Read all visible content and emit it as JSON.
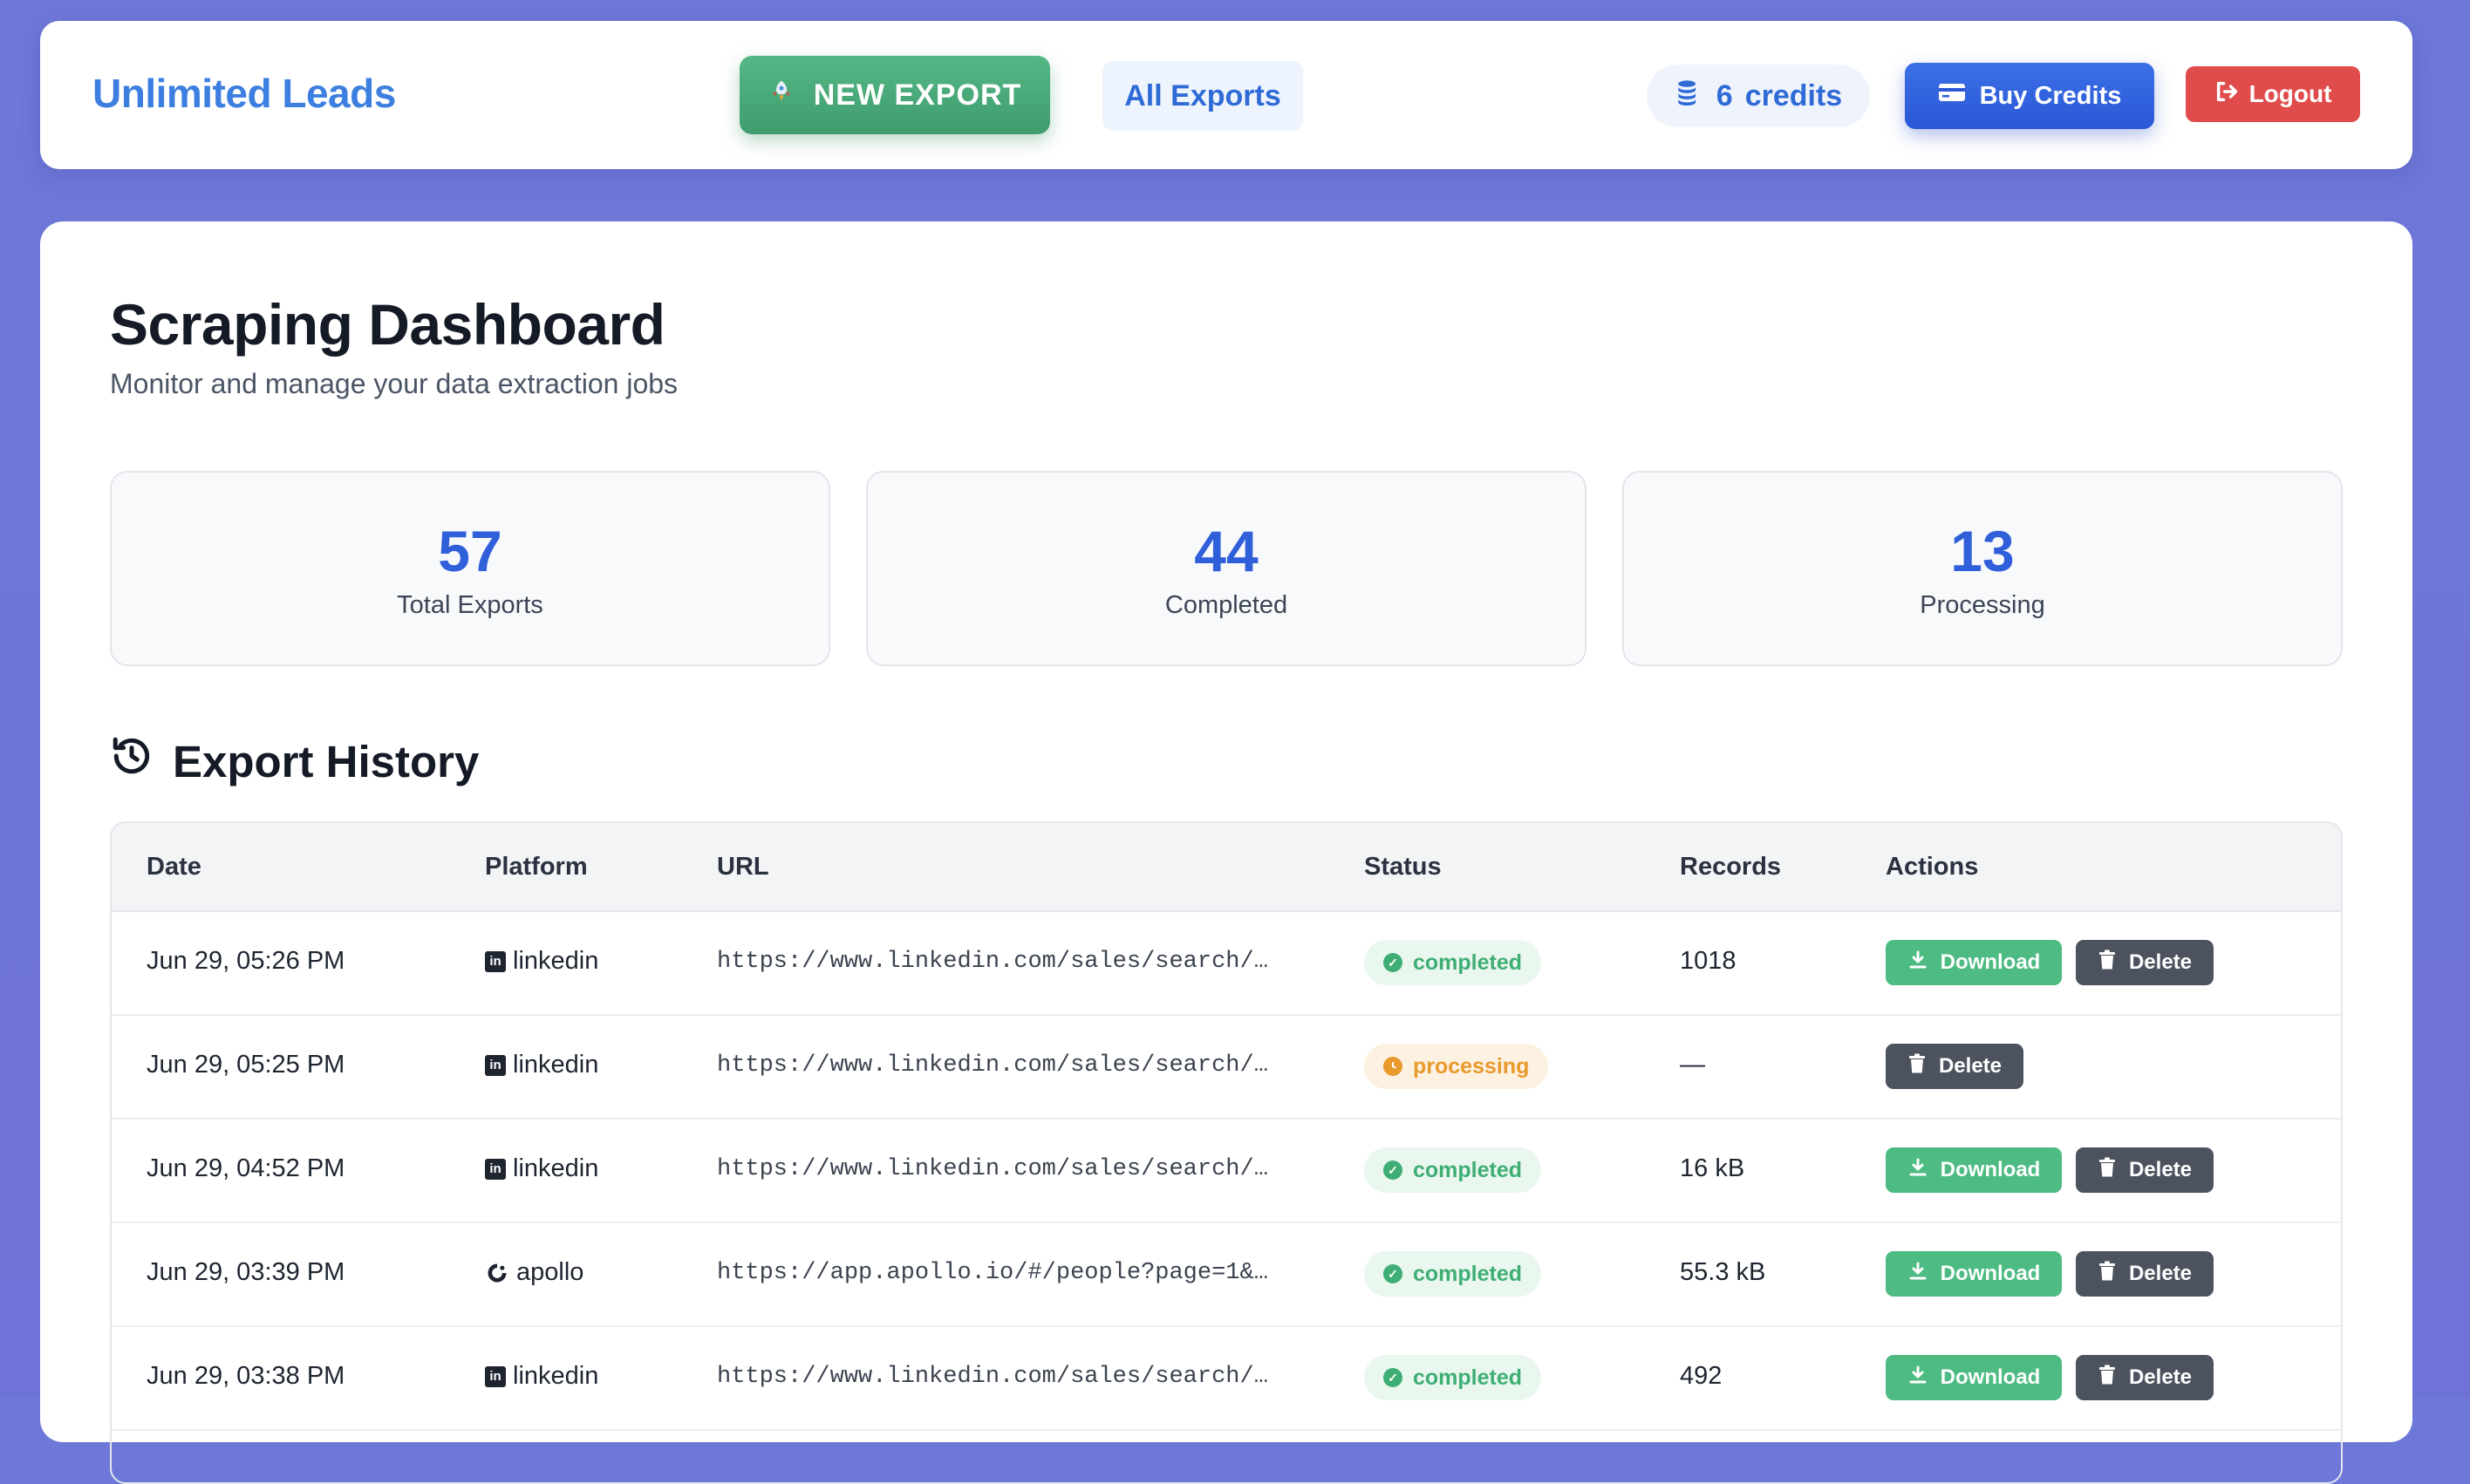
{
  "navbar": {
    "brand": "Unlimited Leads",
    "new_export_label": "NEW EXPORT",
    "new_export_icon": "rocket-icon",
    "all_exports_label": "All Exports",
    "credits_count": "6",
    "credits_label": "credits",
    "credits_icon": "coins-icon",
    "buy_credits_label": "Buy Credits",
    "buy_credits_icon": "credit-card-icon",
    "logout_label": "Logout",
    "logout_icon": "sign-out-icon"
  },
  "header": {
    "title": "Scraping Dashboard",
    "subtitle": "Monitor and manage your data extraction jobs"
  },
  "stats": [
    {
      "value": "57",
      "label": "Total Exports"
    },
    {
      "value": "44",
      "label": "Completed"
    },
    {
      "value": "13",
      "label": "Processing"
    }
  ],
  "history": {
    "title": "Export History",
    "icon": "history-icon",
    "columns": [
      "Date",
      "Platform",
      "URL",
      "Status",
      "Records",
      "Actions"
    ],
    "download_label": "Download",
    "delete_label": "Delete",
    "rows": [
      {
        "date": "Jun 29, 05:26 PM",
        "platform": "linkedin",
        "url": "https://www.linkedin.com/sales/search/…",
        "status": "completed",
        "records": "1018"
      },
      {
        "date": "Jun 29, 05:25 PM",
        "platform": "linkedin",
        "url": "https://www.linkedin.com/sales/search/…",
        "status": "processing",
        "records": "—"
      },
      {
        "date": "Jun 29, 04:52 PM",
        "platform": "linkedin",
        "url": "https://www.linkedin.com/sales/search/…",
        "status": "completed",
        "records": "16 kB"
      },
      {
        "date": "Jun 29, 03:39 PM",
        "platform": "apollo",
        "url": "https://app.apollo.io/#/people?page=1&…",
        "status": "completed",
        "records": "55.3 kB"
      },
      {
        "date": "Jun 29, 03:38 PM",
        "platform": "linkedin",
        "url": "https://www.linkedin.com/sales/search/…",
        "status": "completed",
        "records": "492"
      }
    ]
  },
  "colors": {
    "accent": "#2f5fd9",
    "success": "#4dbb82",
    "warning": "#e89a2c",
    "danger": "#e04c4c"
  }
}
